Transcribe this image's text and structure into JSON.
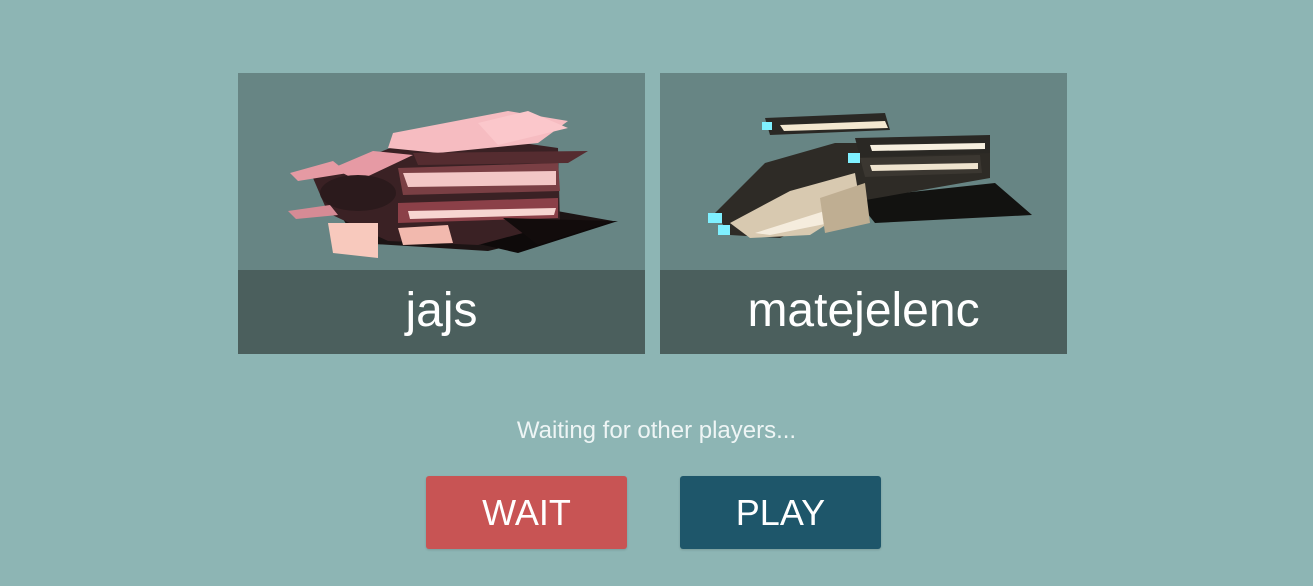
{
  "players": [
    {
      "name": "jajs",
      "ship_color": "#f2a8b0",
      "icon": "pink-spaceship-icon"
    },
    {
      "name": "matejelenc",
      "ship_color": "#e8dccb",
      "icon": "tan-spaceship-icon"
    }
  ],
  "status_text": "Waiting for other players...",
  "buttons": {
    "wait_label": "WAIT",
    "play_label": "PLAY"
  },
  "colors": {
    "background": "#8db5b4",
    "card": "#678584",
    "name_bar": "#4b5f5d",
    "wait_button": "#c85454",
    "play_button": "#1e566a",
    "engine_glow": "#7ff0ff"
  }
}
